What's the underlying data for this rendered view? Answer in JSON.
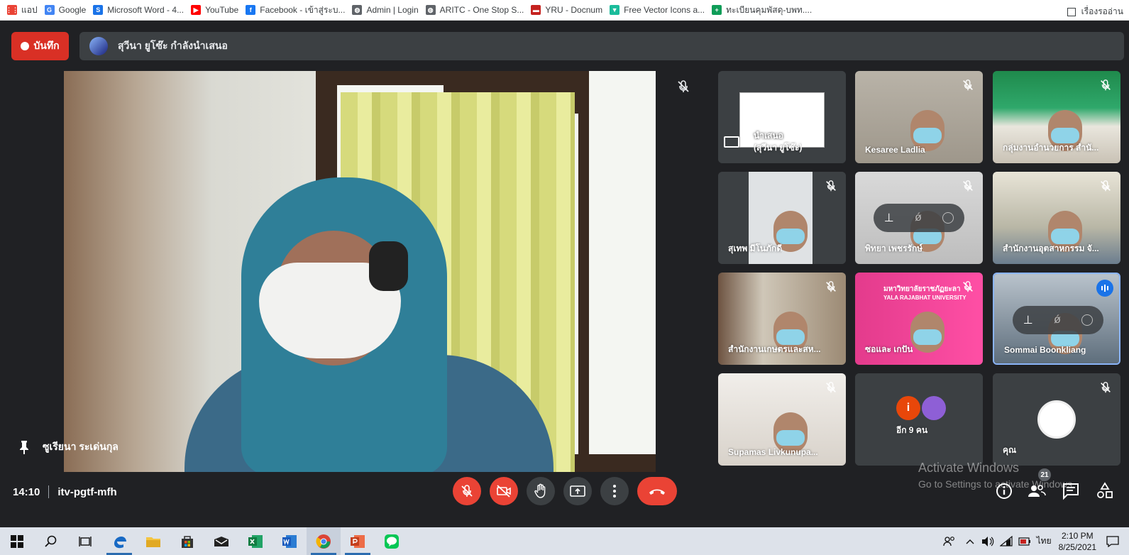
{
  "bookmarks": [
    {
      "label": "แอป",
      "icon": "apps-grid-icon",
      "color": "#ea4335"
    },
    {
      "label": "Google",
      "icon": "google-icon",
      "color": "#4285f4"
    },
    {
      "label": "Microsoft Word - 4...",
      "icon": "spu-icon",
      "color": "#1a73e8"
    },
    {
      "label": "YouTube",
      "icon": "youtube-icon",
      "color": "#ff0000"
    },
    {
      "label": "Facebook - เข้าสู่ระบ...",
      "icon": "facebook-icon",
      "color": "#1877f2"
    },
    {
      "label": "Admin | Login",
      "icon": "globe-icon",
      "color": "#5f6368"
    },
    {
      "label": "ARITC - One Stop S...",
      "icon": "globe-icon",
      "color": "#5f6368"
    },
    {
      "label": "YRU - Docnum",
      "icon": "folder-icon",
      "color": "#c5221f"
    },
    {
      "label": "Free Vector Icons a...",
      "icon": "flaticon-icon",
      "color": "#1bbc9b"
    },
    {
      "label": "ทะเบียนคุมพัสดุ-บพท....",
      "icon": "sheets-icon",
      "color": "#0f9d58"
    }
  ],
  "reading_list": "เรื่องรออ่าน",
  "recording": {
    "label": "บันทึก"
  },
  "presenting": {
    "text": "สุวีนา ยูโซ๊ะ กำลังนำเสนอ"
  },
  "main_speaker": {
    "name": "ซูเรียนา ระเด่นกุล"
  },
  "tiles": [
    {
      "name": "(สุวีนา ยูโซ๊ะ)",
      "subname": "นำเสนอ",
      "kind": "presentation"
    },
    {
      "name": "Kesaree Ladlia",
      "kind": "person"
    },
    {
      "name": "กลุ่มงานอำนวยการ สำนั...",
      "kind": "room"
    },
    {
      "name": "สุเทพ มีโนภักดี",
      "kind": "person"
    },
    {
      "name": "พิทยา เพชรรักษ์",
      "kind": "person"
    },
    {
      "name": "สำนักงานอุตสาหกรรม จั...",
      "kind": "room"
    },
    {
      "name": "สำนักงานเกษตรและสห...",
      "kind": "person"
    },
    {
      "name": "ซอและ เกปัน",
      "kind": "person",
      "overlay": "มหาวิทยาลัยราชภัฏยะลา",
      "overlay2": "YALA RAJABHAT UNIVERSITY"
    },
    {
      "name": "Sommai Boonkliang",
      "kind": "person"
    },
    {
      "name": "Supamas Livkunupa...",
      "kind": "person"
    },
    {
      "name": "อีก 9 คน",
      "kind": "more"
    },
    {
      "name": "คุณ",
      "kind": "self"
    }
  ],
  "controls": {
    "time": "14:10",
    "meeting_code": "itv-pgtf-mfh",
    "participant_count": "21"
  },
  "watermark": {
    "title": "Activate Windows",
    "subtitle": "Go to Settings to activate Windows."
  },
  "taskbar": {
    "language": "ไทย",
    "time": "2:10 PM",
    "date": "8/25/2021"
  }
}
